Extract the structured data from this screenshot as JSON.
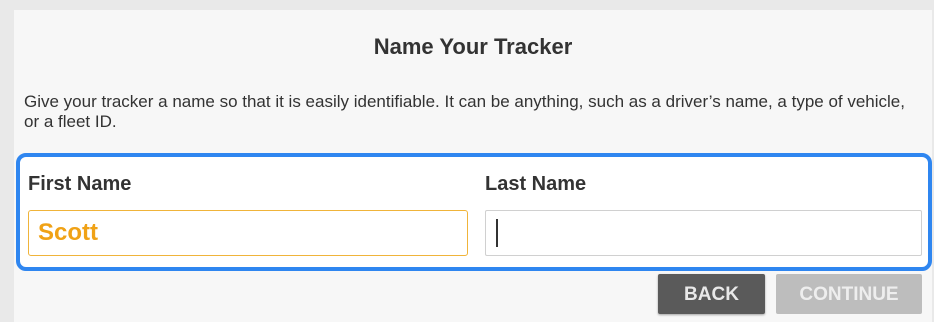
{
  "dialog": {
    "title": "Name Your Tracker",
    "description": "Give your tracker a name so that it is easily identifiable. It can be anything, such as a driver’s name, a type of vehicle, or a fleet ID."
  },
  "form": {
    "first_name": {
      "label": "First Name",
      "value": "Scott"
    },
    "last_name": {
      "label": "Last Name",
      "value": ""
    }
  },
  "buttons": {
    "back_label": "BACK",
    "continue_label": "CONTINUE"
  },
  "colors": {
    "highlight_border": "#2f86f0",
    "first_name_text": "#f0a216",
    "first_name_border": "#f0b43a",
    "back_button": "#5a5a5a",
    "continue_button_disabled": "#bdbdbd"
  }
}
